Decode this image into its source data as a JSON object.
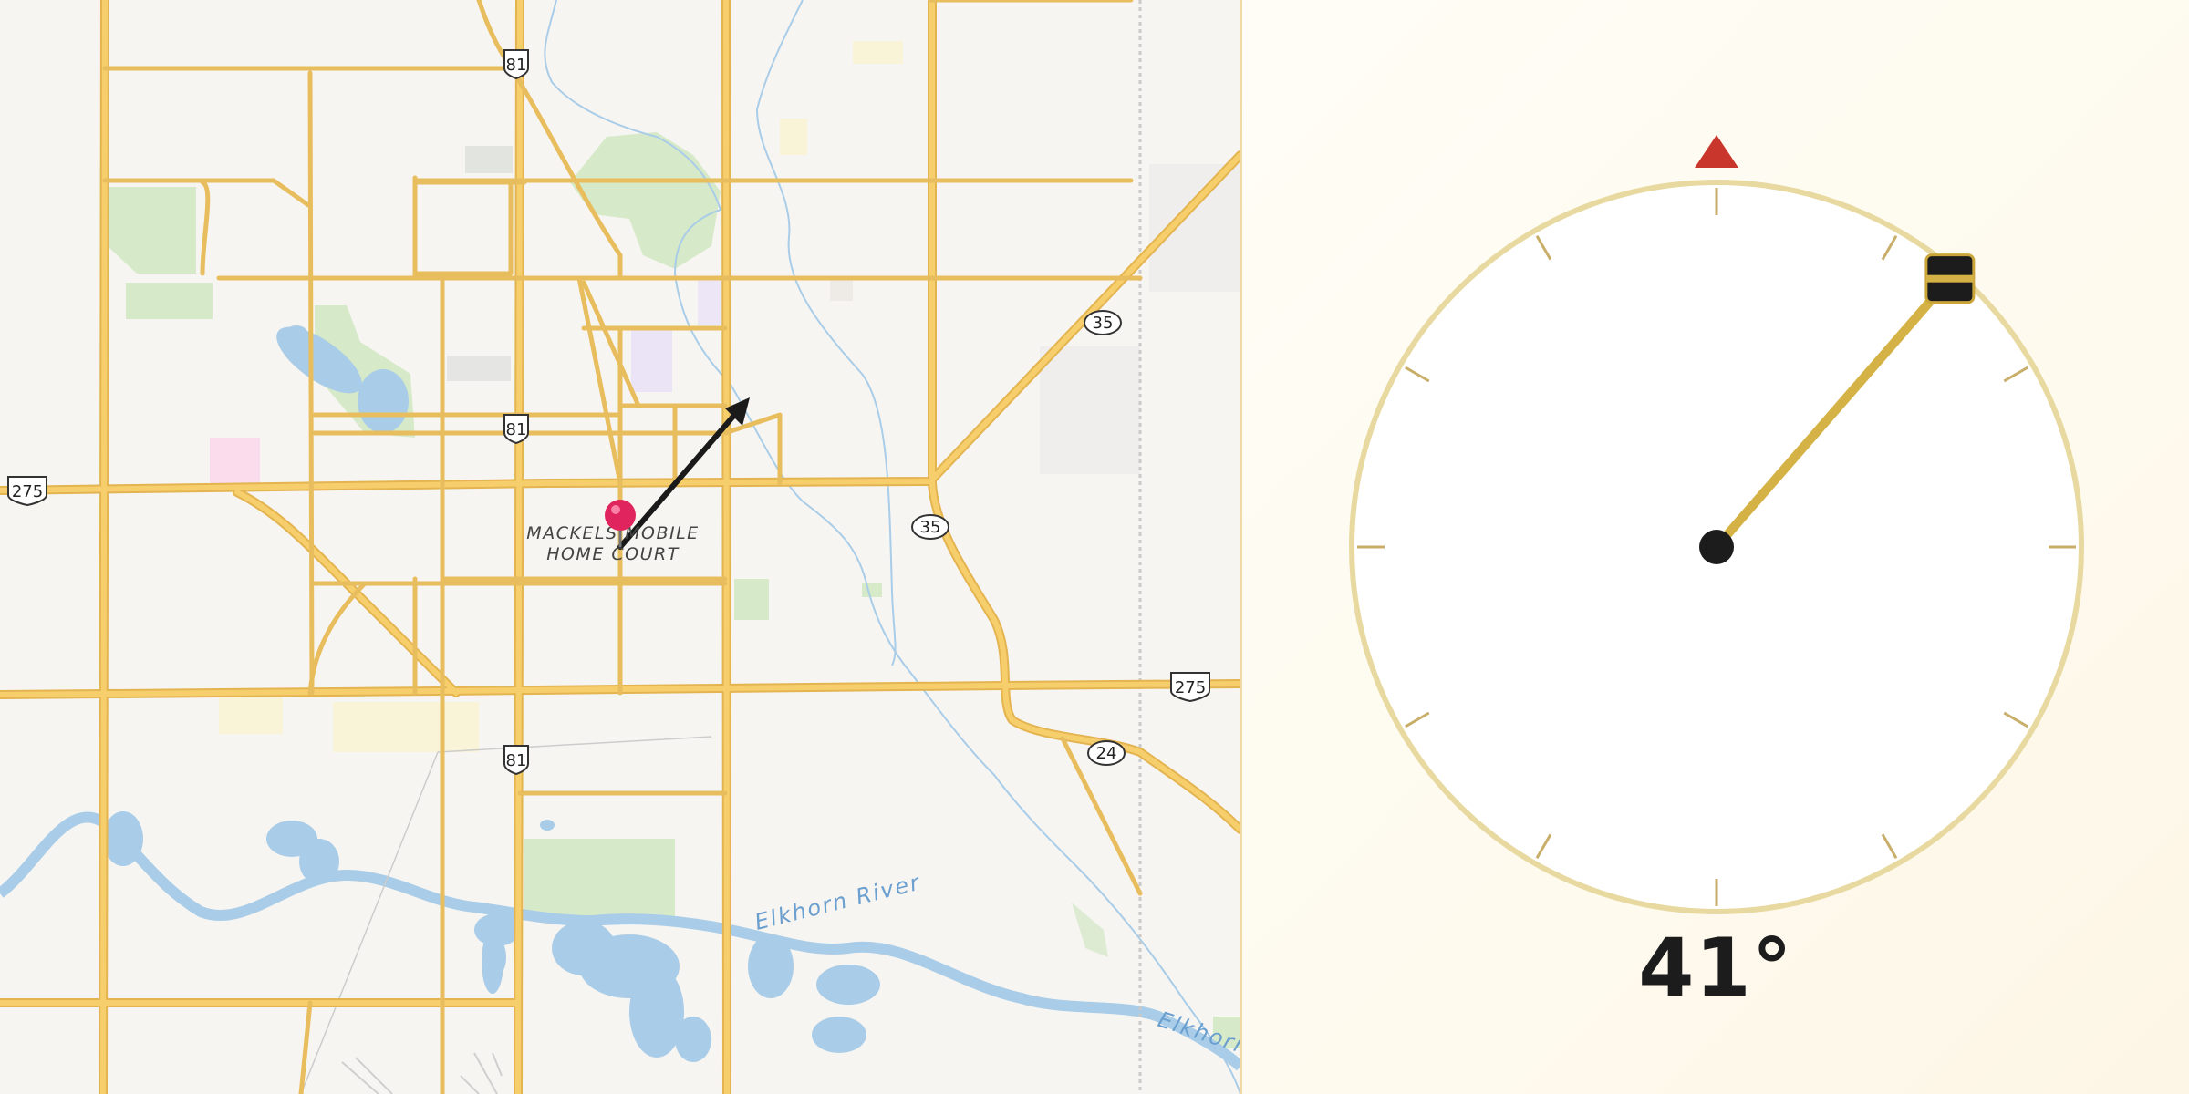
{
  "map": {
    "poi": {
      "label_line1": "MACKELS MOBILE",
      "label_line2": "HOME COURT",
      "pin_color": "#e0245e"
    },
    "river_labels": [
      "Elkhorn River",
      "Elkhorn"
    ],
    "shields": [
      {
        "type": "us",
        "number": "81"
      },
      {
        "type": "us",
        "number": "81"
      },
      {
        "type": "us",
        "number": "81"
      },
      {
        "type": "us",
        "number": "275"
      },
      {
        "type": "us",
        "number": "275"
      },
      {
        "type": "state",
        "number": "35"
      },
      {
        "type": "state",
        "number": "35"
      },
      {
        "type": "state",
        "number": "24"
      }
    ],
    "colors": {
      "road": "#f6cf6c",
      "road_casing": "#e3b450",
      "water": "#a9cde8",
      "park": "#d6e9c8",
      "land": "#f7f5f1"
    }
  },
  "compass": {
    "heading_degrees": 41,
    "heading_text": "41°",
    "north_marker_color": "#c9362b",
    "needle_color": "#d4b245",
    "ring_color": "#e8d9a0"
  }
}
